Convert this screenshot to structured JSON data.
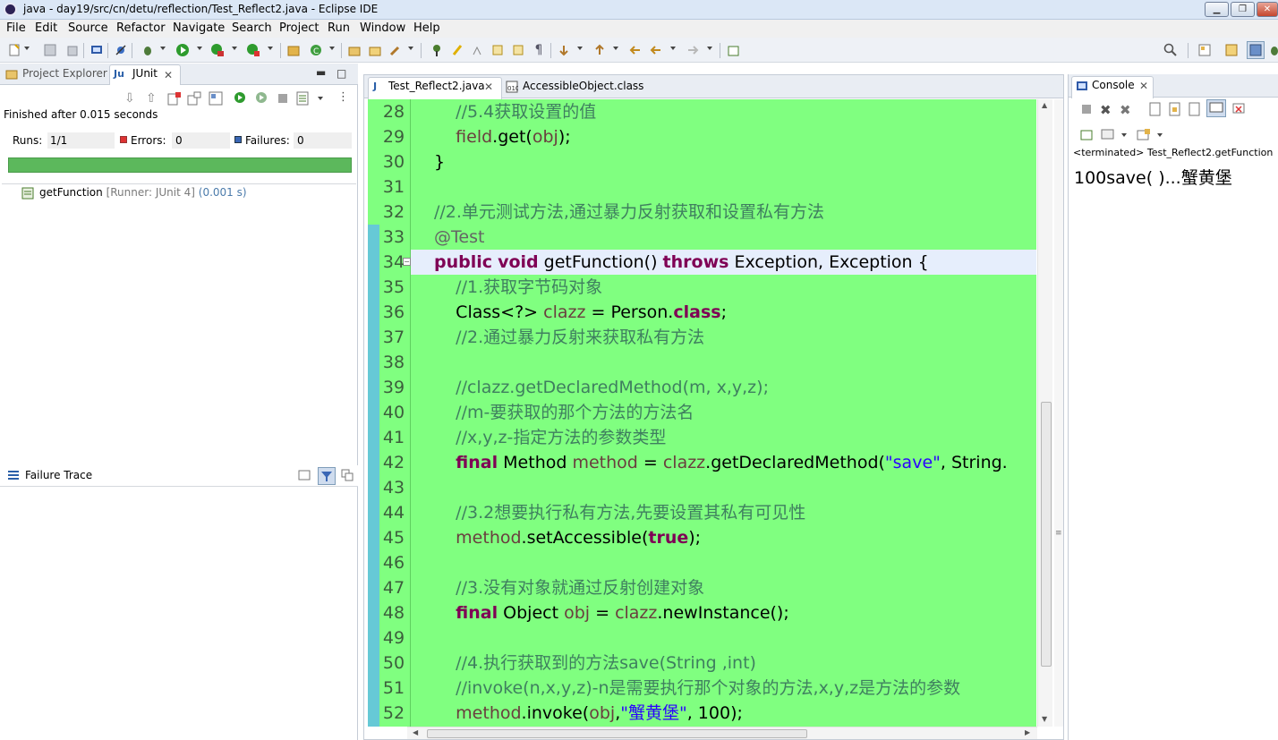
{
  "window": {
    "title": "java - day19/src/cn/detu/reflection/Test_Reflect2.java - Eclipse IDE",
    "minimize": "▁",
    "maximize": "❐",
    "close": "✕"
  },
  "menu": {
    "items": [
      "File",
      "Edit",
      "Source",
      "Refactor",
      "Navigate",
      "Search",
      "Project",
      "Run",
      "Window",
      "Help"
    ]
  },
  "left_panel": {
    "tabs": [
      "Project Explorer",
      "JUnit"
    ],
    "finished_text": "Finished after 0.015 seconds",
    "runs_label": "Runs:",
    "runs_value": "1/1",
    "errors_label": "Errors:",
    "errors_value": "0",
    "failures_label": "Failures:",
    "failures_value": "0",
    "progress": 1.0,
    "progress_color": "#5cb85c",
    "test": {
      "name": "getFunction",
      "runner": "[Runner: JUnit 4]",
      "time": "(0.001 s)"
    },
    "failure_trace_label": "Failure Trace"
  },
  "editor": {
    "tabs": [
      "Test_Reflect2.java",
      "AccessibleObject.class"
    ],
    "line_numbers": [
      "28",
      "29",
      "30",
      "31",
      "32",
      "33",
      "34",
      "35",
      "36",
      "37",
      "38",
      "39",
      "40",
      "41",
      "42",
      "43",
      "44",
      "45",
      "46",
      "47",
      "48",
      "49",
      "50",
      "51",
      "52"
    ],
    "highlight_color": "#80ff80"
  },
  "console": {
    "tab": "Console",
    "terminated": "<terminated> Test_Reflect2.getFunction",
    "output": "100save( )...蟹黄堡"
  }
}
